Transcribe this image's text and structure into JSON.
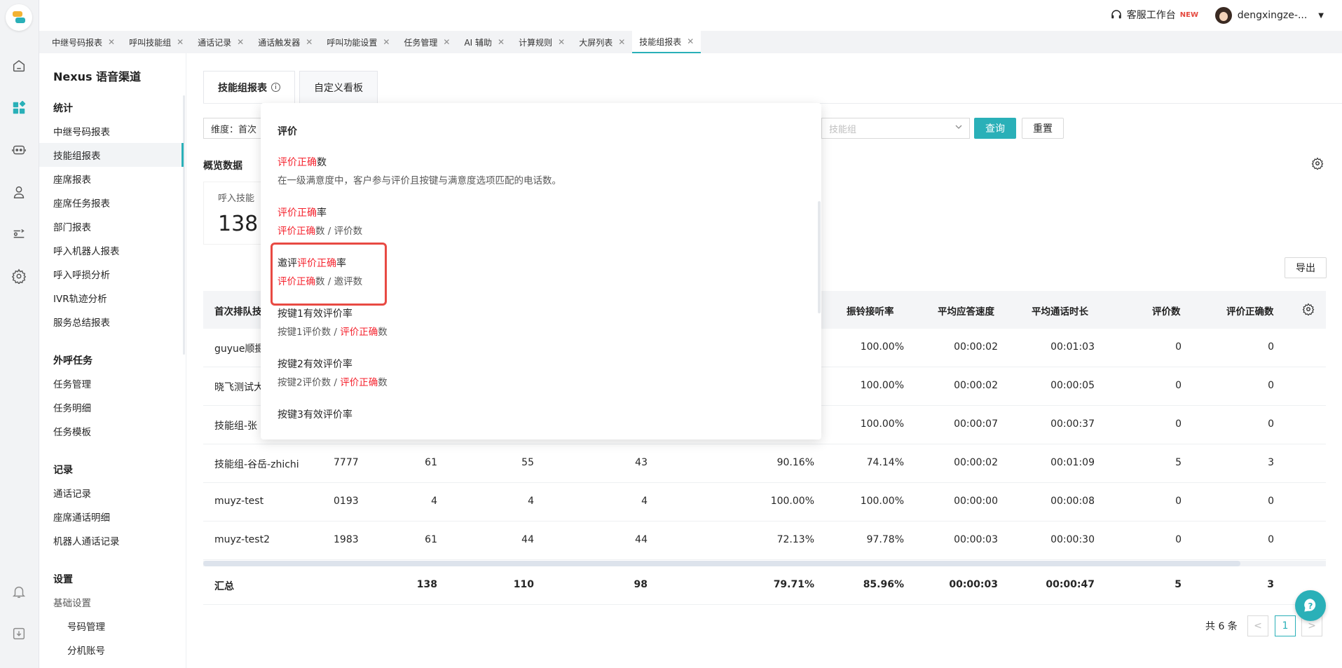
{
  "topbar": {
    "workspace_label": "客服工作台",
    "workspace_badge": "NEW",
    "user_name": "dengxingze-..."
  },
  "tabs": [
    {
      "label": "中继号码报表"
    },
    {
      "label": "呼叫技能组"
    },
    {
      "label": "通话记录"
    },
    {
      "label": "通话触发器"
    },
    {
      "label": "呼叫功能设置"
    },
    {
      "label": "任务管理"
    },
    {
      "label": "AI 辅助"
    },
    {
      "label": "计算规则"
    },
    {
      "label": "大屏列表"
    },
    {
      "label": "技能组报表"
    }
  ],
  "sidebar": {
    "app_title": "Nexus 语音渠道",
    "groups": {
      "stats": "统计",
      "outbound": "外呼任务",
      "records": "记录",
      "settings": "设置"
    },
    "stats_items": [
      "中继号码报表",
      "技能组报表",
      "座席报表",
      "座席任务报表",
      "部门报表",
      "呼入机器人报表",
      "呼入呼损分析",
      "IVR轨迹分析",
      "服务总结报表"
    ],
    "outbound_items": [
      "任务管理",
      "任务明细",
      "任务模板"
    ],
    "records_items": [
      "通话记录",
      "座席通话明细",
      "机器人通话记录"
    ],
    "settings_items": [
      "基础设置",
      "号码管理",
      "分机账号"
    ]
  },
  "main": {
    "subtab_report": "技能组报表",
    "subtab_custom": "自定义看板",
    "dimension_prefix": "维度：首次",
    "skill_placeholder": "技能组",
    "query_btn": "查询",
    "reset_btn": "重置",
    "overview_title": "概览数据",
    "card_label": "呼入技能",
    "card_value": "138",
    "export_btn": "导出"
  },
  "table": {
    "headers": {
      "c0": "首次排队技",
      "ring_rate": "振铃接听率",
      "avg_answer": "平均应答速度",
      "avg_talk": "平均通话时长",
      "eval_count": "评价数",
      "eval_correct": "评价正确数"
    },
    "rows": [
      {
        "name": "guyue顺掘",
        "code": "",
        "a": "",
        "b": "",
        "c": "",
        "d": "",
        "ring": "100.00%",
        "ans": "00:00:02",
        "talk": "00:01:03",
        "ev": "0",
        "ec": "0"
      },
      {
        "name": "晓飞测试大",
        "code": "",
        "a": "",
        "b": "",
        "c": "",
        "d": "",
        "ring": "100.00%",
        "ans": "00:00:02",
        "talk": "00:00:05",
        "ev": "0",
        "ec": "0"
      },
      {
        "name": "技能组-张",
        "code": "",
        "a": "",
        "b": "",
        "c": "",
        "d": "",
        "ring": "100.00%",
        "ans": "00:00:07",
        "talk": "00:00:37",
        "ev": "0",
        "ec": "0"
      },
      {
        "name": "技能组-谷岳-zhichi",
        "code": "7777",
        "a": "61",
        "b": "55",
        "c": "43",
        "d": "90.16%",
        "ring": "74.14%",
        "ans": "00:00:02",
        "talk": "00:01:09",
        "ev": "5",
        "ec": "3"
      },
      {
        "name": "muyz-test",
        "code": "0193",
        "a": "4",
        "b": "4",
        "c": "4",
        "d": "100.00%",
        "ring": "100.00%",
        "ans": "00:00:00",
        "talk": "00:00:08",
        "ev": "0",
        "ec": "0"
      },
      {
        "name": "muyz-test2",
        "code": "1983",
        "a": "61",
        "b": "44",
        "c": "44",
        "d": "72.13%",
        "ring": "97.78%",
        "ans": "00:00:03",
        "talk": "00:00:30",
        "ev": "0",
        "ec": "0"
      }
    ],
    "total": {
      "name": "汇总",
      "a": "138",
      "b": "110",
      "c": "98",
      "d": "79.71%",
      "ring": "85.96%",
      "ans": "00:00:03",
      "talk": "00:00:47",
      "ev": "5",
      "ec": "3"
    }
  },
  "pagination": {
    "total_text": "共 6 条",
    "current_page": "1",
    "prev": "<",
    "next": ">"
  },
  "popover": {
    "heading": "评价",
    "e1_hl": "评价正确",
    "e1_rest": "数",
    "e1_desc": "在一级满意度中，客户参与评价且按键与满意度选项匹配的电话数。",
    "e2_hl": "评价正确",
    "e2_rest": "率",
    "e2_d_hl": "评价正确",
    "e2_d_rest": "数 / 评价数",
    "e3_pre": "邀评",
    "e3_hl": "评价正确",
    "e3_rest": "率",
    "e3_d_hl": "评价正确",
    "e3_d_rest": "数 / 邀评数",
    "e4_title": "按键1有效评价率",
    "e4_d_pre": "按键1评价数 / ",
    "e4_d_hl": "评价正确",
    "e4_d_rest": "数",
    "e5_title": "按键2有效评价率",
    "e5_d_pre": "按键2评价数 / ",
    "e5_d_hl": "评价正确",
    "e5_d_rest": "数",
    "e6_title": "按键3有效评价率"
  },
  "colors": {
    "accent": "#2ab0b8",
    "highlight": "#f5222d",
    "box": "#e84a43"
  }
}
